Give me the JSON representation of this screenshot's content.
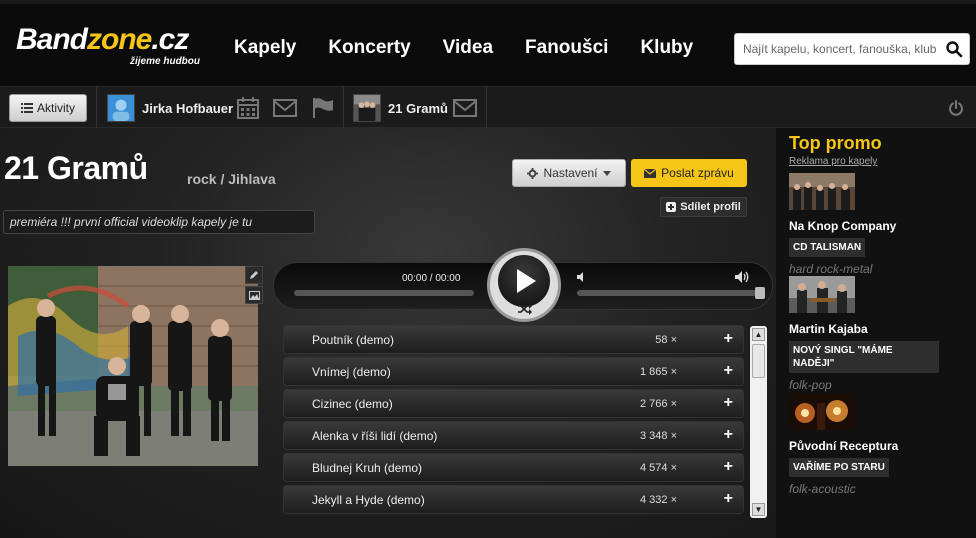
{
  "header": {
    "logo_main_white": "Band",
    "logo_main_yellow": "zone",
    "logo_domain": ".cz",
    "logo_tagline": "žijeme hudbou",
    "nav": [
      "Kapely",
      "Koncerty",
      "Videa",
      "Fanoušci",
      "Kluby"
    ],
    "search_placeholder": "Najít kapelu, koncert, fanouška, klub"
  },
  "toolbar": {
    "activity_label": "Aktivity",
    "user_name": "Jirka Hofbauer",
    "band_name": "21 Gramů"
  },
  "band": {
    "title": "21 Gramů",
    "genre": "rock / Jihlava",
    "settings_label": "Nastavení",
    "message_label": "Poslat zprávu",
    "share_label": "Sdílet profil",
    "status": "premiéra !!! první official videoklip kapely je tu"
  },
  "player": {
    "time": "00:00 / 00:00"
  },
  "tracks": [
    {
      "name": "Poutník (demo)",
      "count": "58 ×"
    },
    {
      "name": "Vnímej (demo)",
      "count": "1 865 ×"
    },
    {
      "name": "Cizinec (demo)",
      "count": "2 766 ×"
    },
    {
      "name": "Alenka v říši lidí (demo)",
      "count": "3 348 ×"
    },
    {
      "name": "Bludnej Kruh (demo)",
      "count": "4 574 ×"
    },
    {
      "name": "Jekyll a Hyde (demo)",
      "count": "4 332 ×"
    }
  ],
  "sidebar": {
    "title": "Top promo",
    "ad_link": "Reklama pro kapely",
    "promos": [
      {
        "name": "Na Knop Company",
        "tag": "CD TALISMAN",
        "genre": "hard rock-metal"
      },
      {
        "name": "Martin Kajaba",
        "tag": "NOVÝ SINGL \"MÁME NADĚJI\"",
        "genre": "folk-pop"
      },
      {
        "name": "Původní Receptura",
        "tag": "VAŘÍME PO STARU",
        "genre": "folk-acoustic"
      }
    ]
  },
  "colors": {
    "accent": "#f5c518",
    "background": "#111111"
  }
}
